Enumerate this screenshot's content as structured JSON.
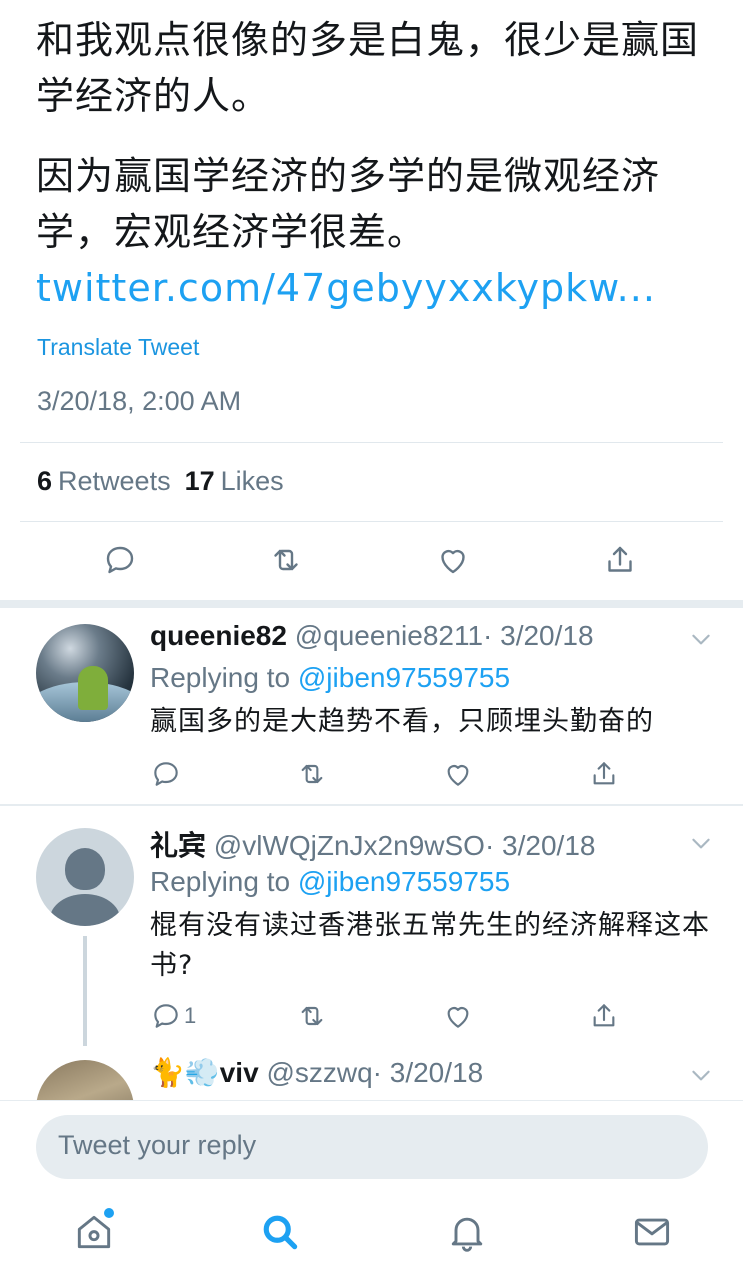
{
  "tweet": {
    "paragraph1": "和我观点很像的多是白鬼，很少是赢国学经济的人。",
    "paragraph2": "因为赢国学经济的多学的是微观经济学，宏观经济学很差。",
    "link_text": " twitter.com/47gebyyxxkypkw...",
    "translate_label": "Translate Tweet",
    "timestamp": "3/20/18, 2:00 AM"
  },
  "stats": {
    "retweet_count": "6",
    "retweet_label": "Retweets",
    "like_count": "17",
    "like_label": "Likes"
  },
  "replies": [
    {
      "display_name": "queenie82",
      "handle": "@queenie8211",
      "time": "· 3/20/18",
      "replying_prefix": "Replying to ",
      "replying_to": "@jiben97559755",
      "text": "赢国多的是大趋势不看，只顾埋头勤奋的",
      "reply_count": ""
    },
    {
      "display_name": "礼宾",
      "handle": "@vlWQjZnJx2n9wSO",
      "time": "· 3/20/18",
      "replying_prefix": "Replying to ",
      "replying_to": "@jiben97559755",
      "text": "棍有没有读过香港张五常先生的经济解释这本书?",
      "reply_count": "1"
    },
    {
      "display_name": "🐈💨viv",
      "handle": "@szzwq",
      "time": "· 3/20/18"
    }
  ],
  "compose": {
    "placeholder": "Tweet your reply"
  },
  "icons": {
    "reply": "reply-icon",
    "retweet": "retweet-icon",
    "like": "heart-icon",
    "share": "share-icon",
    "more": "chevron-down-icon",
    "nav_home": "home-icon",
    "nav_search": "search-icon",
    "nav_notifications": "bell-icon",
    "nav_messages": "mail-icon"
  },
  "colors": {
    "accent": "#1da1f2",
    "secondary_text": "#657786",
    "primary_text": "#14171a"
  }
}
